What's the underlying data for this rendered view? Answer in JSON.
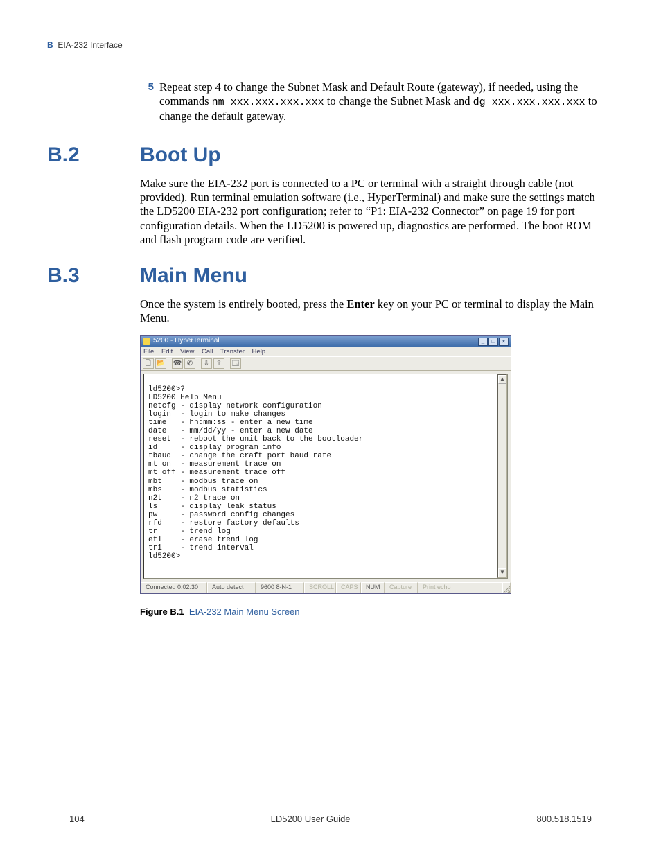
{
  "header": {
    "appendix_letter": "B",
    "appendix_title": "EIA-232 Interface"
  },
  "step5": {
    "number": "5",
    "text_parts": {
      "p1": "Repeat step 4 to change the Subnet Mask and Default Route (gateway), if needed, using the commands ",
      "code1": "nm xxx.xxx.xxx.xxx",
      "p2": " to change the Subnet Mask and ",
      "code2": "dg xxx.xxx.xxx.xxx",
      "p3": " to change the default gateway."
    }
  },
  "section_b2": {
    "num": "B.2",
    "title": "Boot Up",
    "para": "Make sure the EIA-232 port is connected to a PC or terminal with a straight through cable (not provided). Run terminal emulation software (i.e., HyperTerminal) and make sure the settings match the LD5200 EIA-232 port configuration; refer to “P1: EIA-232 Connector” on page 19 for port configuration details. When the LD5200 is powered up, diagnostics are performed. The boot ROM and flash program code are verified."
  },
  "section_b3": {
    "num": "B.3",
    "title": "Main Menu",
    "para_parts": {
      "p1": "Once the system is entirely booted, press the ",
      "bold": "Enter",
      "p2": " key on your PC or terminal to display the Main Menu."
    }
  },
  "hyperterminal": {
    "title": "5200 - HyperTerminal",
    "menus": [
      "File",
      "Edit",
      "View",
      "Call",
      "Transfer",
      "Help"
    ],
    "toolbar_icons": [
      "new-doc-icon",
      "open-icon",
      "connect-icon",
      "disconnect-icon",
      "send-icon",
      "receive-icon",
      "properties-icon"
    ],
    "terminal_text": "\nld5200>?\nLD5200 Help Menu\nnetcfg - display network configuration\nlogin  - login to make changes\ntime   - hh:mm:ss - enter a new time\ndate   - mm/dd/yy - enter a new date\nreset  - reboot the unit back to the bootloader\nid     - display program info\ntbaud  - change the craft port baud rate\nmt on  - measurement trace on\nmt off - measurement trace off\nmbt    - modbus trace on\nmbs    - modbus statistics\nn2t    - n2 trace on\nls     - display leak status\npw     - password config changes\nrfd    - restore factory defaults\ntr     - trend log\netl    - erase trend log\ntri    - trend interval\nld5200>",
    "status": {
      "connected": "Connected 0:02:30",
      "detect": "Auto detect",
      "baud": "9600 8-N-1",
      "scroll": "SCROLL",
      "caps": "CAPS",
      "num": "NUM",
      "capture": "Capture",
      "print_echo": "Print echo"
    }
  },
  "figure": {
    "label": "Figure B.1",
    "title": "EIA-232 Main Menu Screen"
  },
  "footer": {
    "page": "104",
    "guide": "LD5200 User Guide",
    "phone": "800.518.1519"
  }
}
